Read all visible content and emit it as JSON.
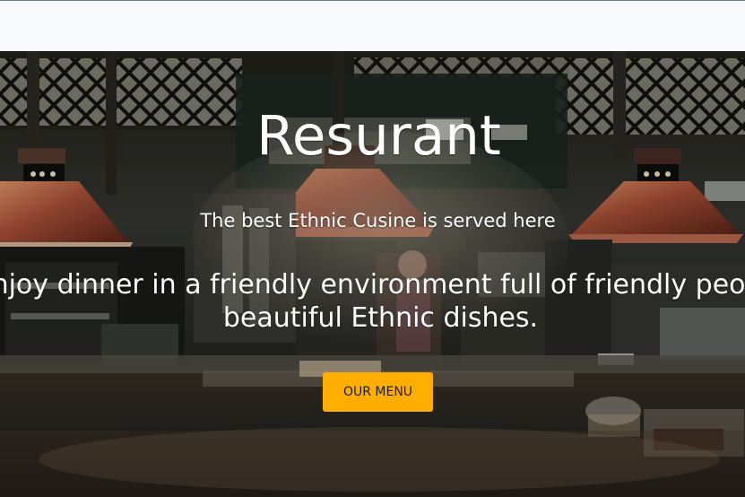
{
  "header": {
    "background": "#f8f9fb"
  },
  "hero": {
    "title": "Resurant",
    "subtitle": "The best Ethnic Cusine is served here",
    "tagline_line1": "Enjoy dinner in a friendly environment full of friendly people",
    "tagline_line2": "beautiful Ethnic dishes.",
    "background": "restaurant-kitchen-photo",
    "button": {
      "label": "OUR MENU",
      "color": "#ffae00"
    }
  },
  "colors": {
    "text": "#ffffff",
    "accent": "#ffae00",
    "dark": "#1f201d"
  }
}
